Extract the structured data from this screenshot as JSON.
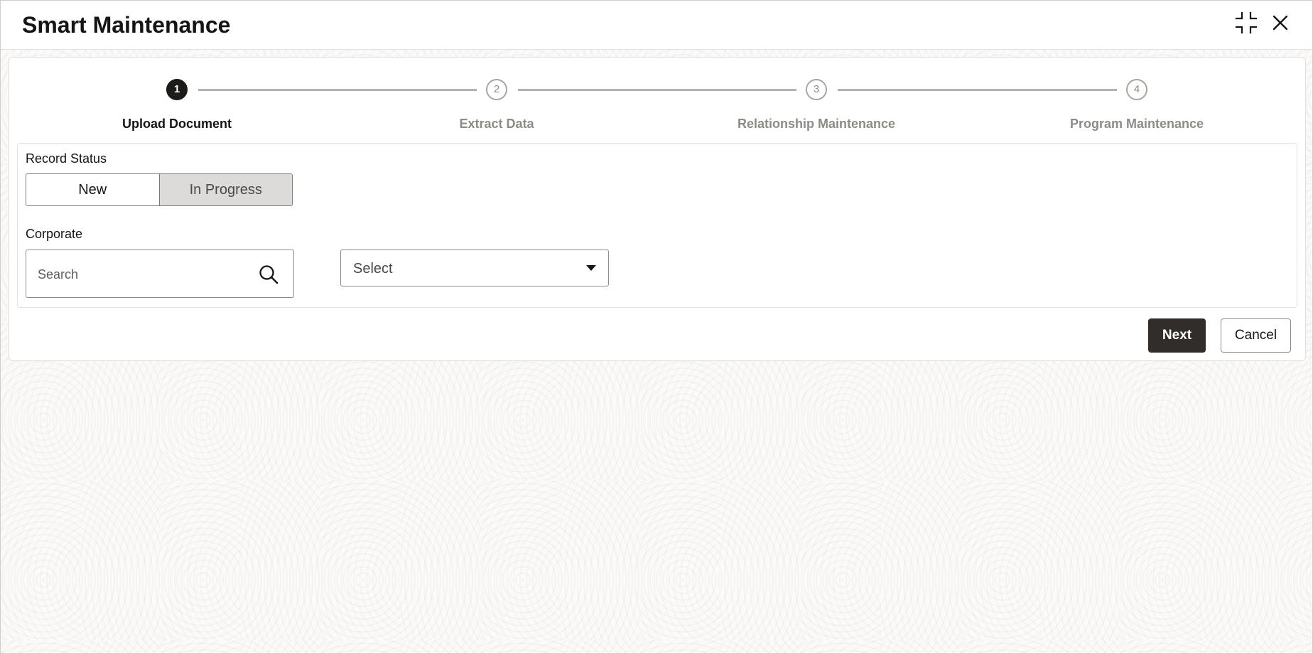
{
  "header": {
    "title": "Smart Maintenance",
    "icons": {
      "minimize": "compress-icon",
      "close": "close-icon"
    }
  },
  "stepper": {
    "steps": [
      {
        "number": "1",
        "label": "Upload Document",
        "state": "active"
      },
      {
        "number": "2",
        "label": "Extract Data",
        "state": "inactive"
      },
      {
        "number": "3",
        "label": "Relationship Maintenance",
        "state": "inactive"
      },
      {
        "number": "4",
        "label": "Program Maintenance",
        "state": "inactive"
      }
    ]
  },
  "form": {
    "record_status": {
      "label": "Record Status",
      "options": [
        "New",
        "In Progress"
      ],
      "selected": "New"
    },
    "corporate": {
      "label": "Corporate",
      "search_placeholder": "Search",
      "search_value": "",
      "select_value": "Select"
    }
  },
  "actions": {
    "next_label": "Next",
    "cancel_label": "Cancel"
  },
  "colors": {
    "primary_button": "#312d2a",
    "active_step": "#1c1b19",
    "inactive_step": "#8e8b87"
  }
}
